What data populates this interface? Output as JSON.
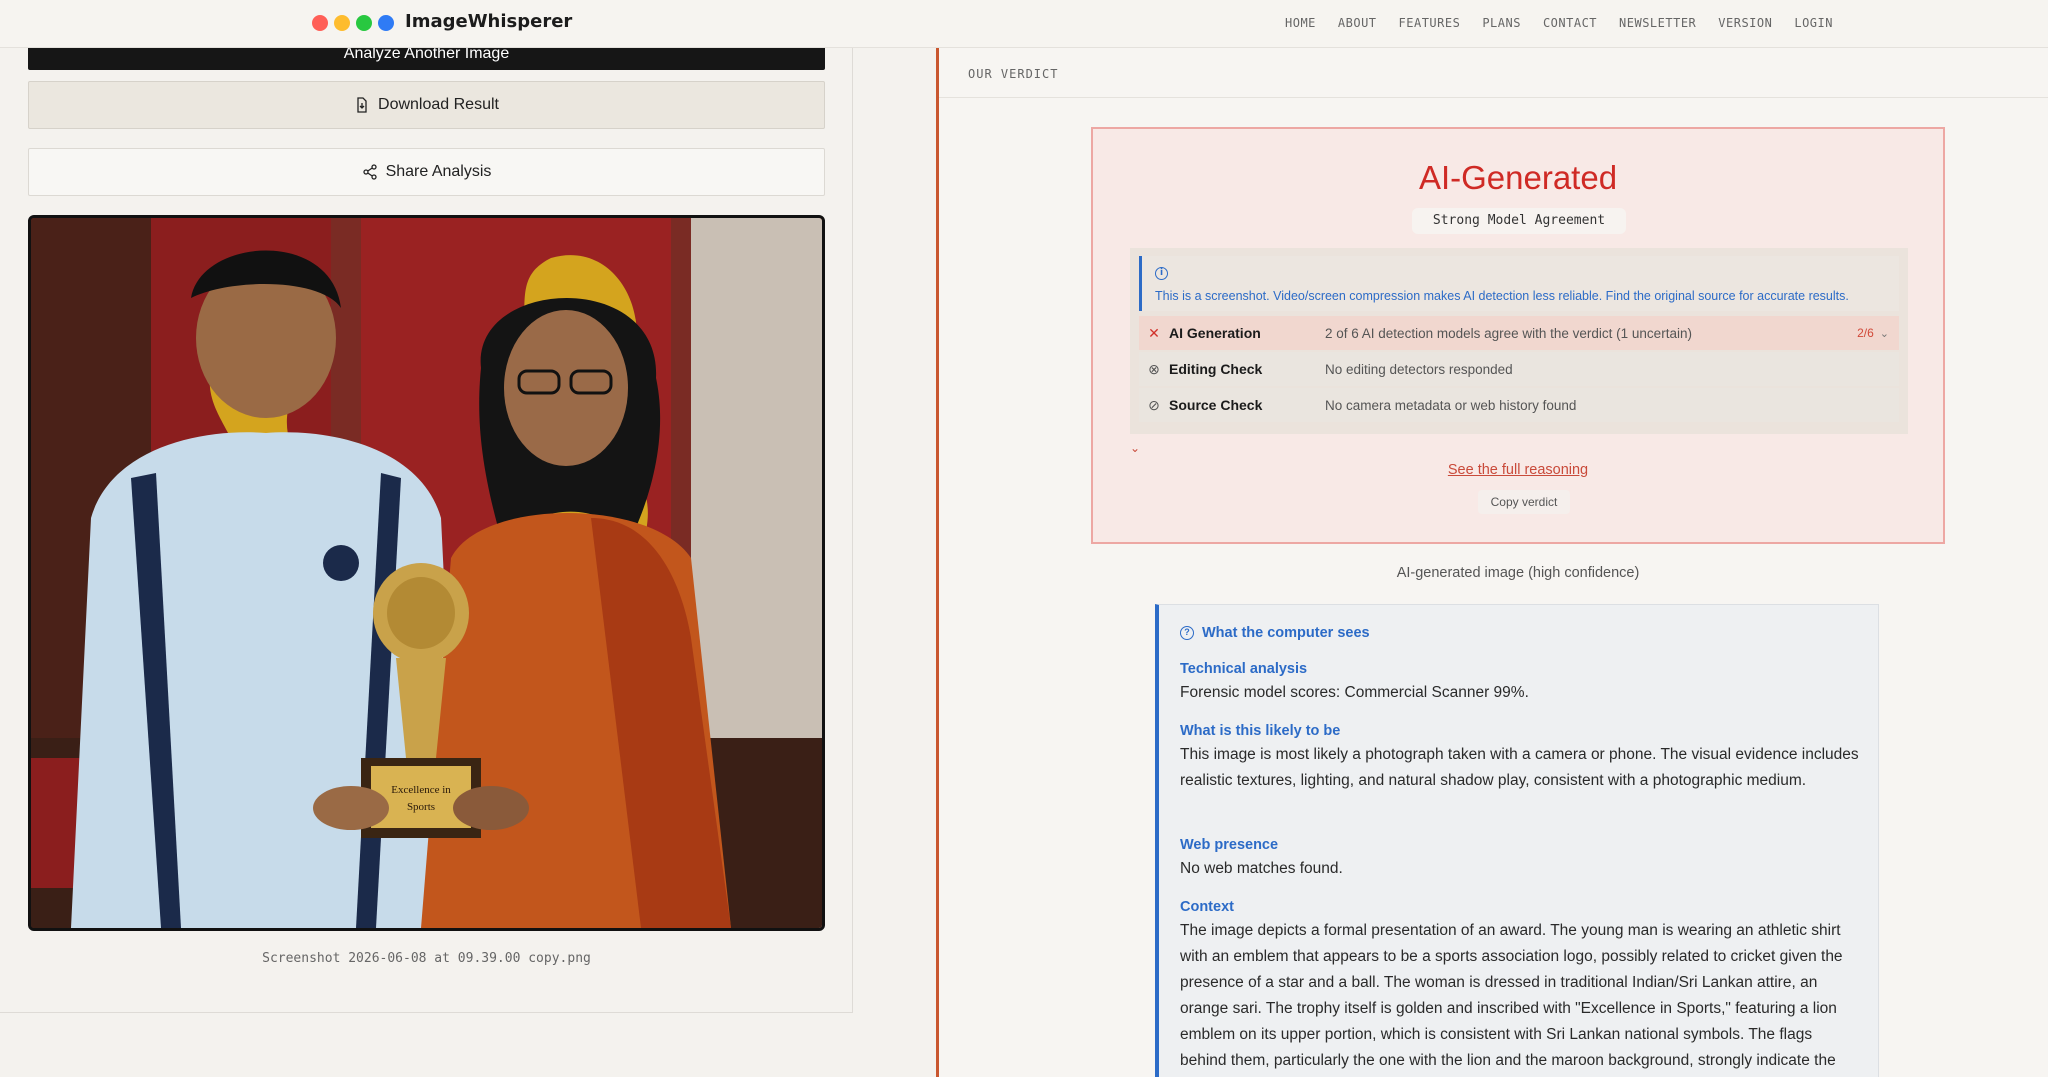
{
  "app": {
    "name": "ImageWhisperer",
    "window_dots": [
      "#ff5f57",
      "#febc2e",
      "#28c840",
      "#2f7bf5"
    ]
  },
  "nav": [
    "HOME",
    "ABOUT",
    "FEATURES",
    "PLANS",
    "CONTACT",
    "NEWSLETTER",
    "VERSION",
    "LOGIN"
  ],
  "left": {
    "analyze_label": "Analyze Another Image",
    "download_label": "Download Result",
    "share_label": "Share Analysis",
    "filename": "Screenshot 2026-06-08 at 09.39.00 copy.png",
    "trophy_text": [
      "Excellence in",
      "Sports"
    ]
  },
  "verdict": {
    "section_label": "OUR VERDICT",
    "title": "AI-Generated",
    "agreement": "Strong Model Agreement",
    "notice_icon": "i",
    "notice": "This is a screenshot. Video/screen compression makes AI detection less reliable. Find the original source for accurate results.",
    "checks": [
      {
        "icon": "✕",
        "label": "AI Generation",
        "detail": "2 of 6 AI detection models agree with the verdict (1 uncertain)",
        "score": "2/6"
      },
      {
        "icon": "⊗",
        "label": "Editing Check",
        "detail": "No editing detectors responded"
      },
      {
        "icon": "⊘",
        "label": "Source Check",
        "detail": "No camera metadata or web history found"
      }
    ],
    "reasoning_link": "See the full reasoning",
    "copy_label": "Copy verdict",
    "confidence": "AI-generated image (high confidence)"
  },
  "explain": {
    "icon": "?",
    "heading": "What the computer sees",
    "sections": [
      {
        "title": "Technical analysis",
        "body": "Forensic model scores: Commercial Scanner 99%."
      },
      {
        "title": "What is this likely to be",
        "body": "This image is most likely a photograph taken with a camera or phone. The visual evidence includes realistic textures, lighting, and natural shadow play, consistent with a photographic medium."
      },
      {
        "title": "Web presence",
        "body": "No web matches found."
      },
      {
        "title": "Context",
        "body": "The image depicts a formal presentation of an award. The young man is wearing an athletic shirt with an emblem that appears to be a sports association logo, possibly related to cricket given the presence of a star and a ball. The woman is dressed in traditional Indian/Sri Lankan attire, an orange sari. The trophy itself is golden and inscribed with \"Excellence in Sports,\" featuring a lion emblem on its upper portion, which is consistent with Sri Lankan national symbols. The flags behind them, particularly the one with the lion and the maroon background, strongly indicate the"
      }
    ]
  }
}
